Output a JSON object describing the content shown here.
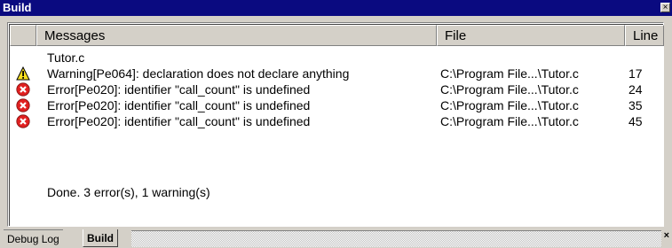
{
  "window": {
    "title": "Build",
    "close_glyph": "×"
  },
  "table": {
    "headers": {
      "messages": "Messages",
      "file": "File",
      "line": "Line"
    },
    "file_group": "Tutor.c",
    "rows": [
      {
        "icon": "warning-icon",
        "message": "Warning[Pe064]: declaration does not declare anything",
        "file": "C:\\Program File...\\Tutor.c",
        "line": "17"
      },
      {
        "icon": "error-icon",
        "message": "Error[Pe020]: identifier \"call_count\" is undefined",
        "file": "C:\\Program File...\\Tutor.c",
        "line": "24"
      },
      {
        "icon": "error-icon",
        "message": "Error[Pe020]: identifier \"call_count\" is undefined",
        "file": "C:\\Program File...\\Tutor.c",
        "line": "35"
      },
      {
        "icon": "error-icon",
        "message": "Error[Pe020]: identifier \"call_count\" is undefined",
        "file": "C:\\Program File...\\Tutor.c",
        "line": "45"
      }
    ],
    "summary": "Done. 3 error(s), 1 warning(s)"
  },
  "tabs": {
    "debug_log": "Debug Log",
    "build": "Build",
    "close_glyph": "×"
  },
  "colors": {
    "title_bar": "#0a0a80",
    "error": "#e02020",
    "warning": "#f8e020"
  }
}
